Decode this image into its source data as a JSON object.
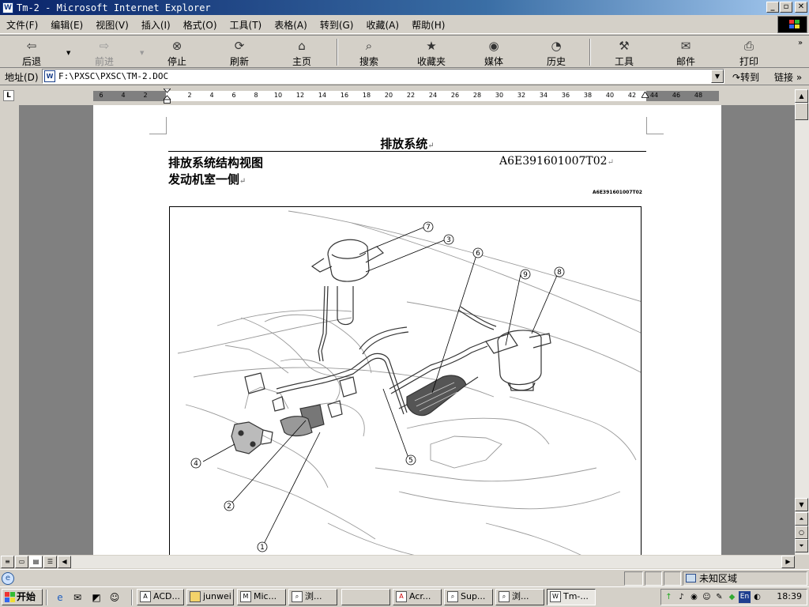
{
  "window": {
    "title": "Tm-2 - Microsoft Internet Explorer",
    "icon": "word-doc-icon"
  },
  "menu": [
    "文件(F)",
    "编辑(E)",
    "视图(V)",
    "插入(I)",
    "格式(O)",
    "工具(T)",
    "表格(A)",
    "转到(G)",
    "收藏(A)",
    "帮助(H)"
  ],
  "toolbar": {
    "back": "后退",
    "forward": "前进",
    "stop": "停止",
    "refresh": "刷新",
    "home": "主页",
    "search": "搜索",
    "favorites": "收藏夹",
    "media": "媒体",
    "history": "历史",
    "tools": "工具",
    "mail": "邮件",
    "print": "打印"
  },
  "address": {
    "label": "地址(D)",
    "value": "F:\\PXSC\\PXSC\\TM-2.DOC",
    "go": "转到",
    "links": "链接"
  },
  "ruler": {
    "left_numbers": [
      "6",
      "4",
      "2"
    ],
    "right_numbers": [
      "2",
      "4",
      "6",
      "8",
      "10",
      "12",
      "14",
      "16",
      "18",
      "20",
      "22",
      "24",
      "26",
      "28",
      "30",
      "32",
      "34",
      "36",
      "38",
      "40",
      "42"
    ],
    "trail_numbers": [
      "44",
      "46",
      "48"
    ]
  },
  "document": {
    "heading": "排放系统",
    "subheading": "排放系统结构视图",
    "code": "A6E391601007T02",
    "subheading2": "发动机室一侧",
    "figure_code": "A6E391601007T02",
    "para_mark": "↵"
  },
  "figure": {
    "callouts": [
      "1",
      "2",
      "3",
      "4",
      "5",
      "6",
      "7",
      "8",
      "9"
    ]
  },
  "status": {
    "zone": "未知区域"
  },
  "taskbar": {
    "start": "开始",
    "tasks": [
      "ACD...",
      "junwei",
      "Mic...",
      "浏...",
      "",
      "Acr...",
      "Sup...",
      "浏...",
      "Tm-..."
    ],
    "time": "18:39"
  }
}
